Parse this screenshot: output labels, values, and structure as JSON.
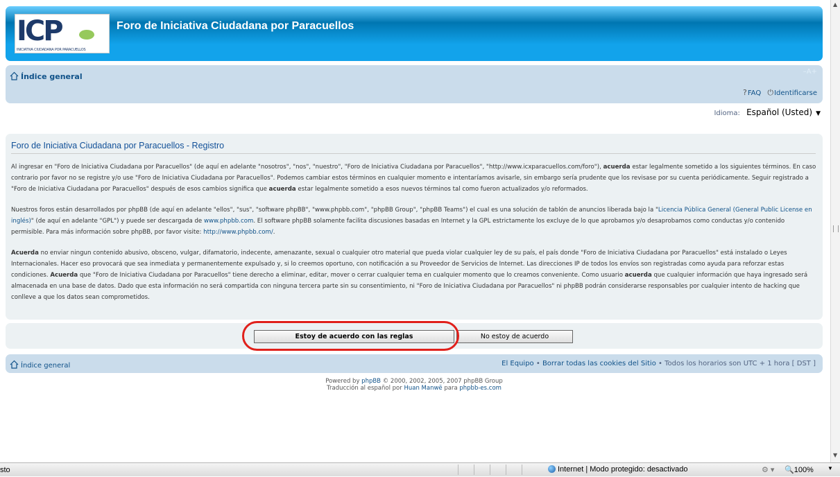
{
  "header": {
    "logo_letters": "ICP",
    "logo_tagline": "INICIATIVA CIUDADANA POR PARACUELLOS",
    "site_title": "Foro de Iniciativa Ciudadana por Paracuellos"
  },
  "navbar": {
    "home_label": "Índice general",
    "font_resize": "–A+",
    "faq_label": "FAQ",
    "login_label": "Identificarse"
  },
  "language": {
    "label": "Idioma:",
    "selected": "Español (Usted)"
  },
  "panel": {
    "title": "Foro de Iniciativa Ciudadana por Paracuellos - Registro",
    "p1_a": "Al ingresar en \"Foro de Iniciativa Ciudadana por Paracuellos\" (de aquí en adelante \"nosotros\", \"nos\", \"nuestro\", \"Foro de Iniciativa Ciudadana por Paracuellos\", \"http://www.icxparacuellos.com/foro\"), ",
    "p1_b": "acuerda",
    "p1_c": " estar legalmente sometido a los siguientes términos. En caso contrario por favor no se registre y/o use \"Foro de Iniciativa Ciudadana por Paracuellos\". Podemos cambiar estos términos en cualquier momento e intentaríamos avisarle, sin embargo sería prudente que los revisase por su cuenta periódicamente. Seguir registrado a \"Foro de Iniciativa Ciudadana por Paracuellos\" después de esos cambios significa que ",
    "p1_d": "acuerda",
    "p1_e": " estar legalmente sometido a esos nuevos términos tal como fueron actualizados y/o reformados.",
    "p2_a": "Nuestros foros están desarrollados por phpBB (de aquí en adelante \"ellos\", \"sus\", \"software phpBB\", \"www.phpbb.com\", \"phpBB Group\", \"phpBB Teams\") el cual es una solución de tablón de anuncios liberada bajo la \"",
    "p2_link1": "Licencia Pública General (General Public License en inglés)",
    "p2_b": "\" (de aquí en adelante \"GPL\") y puede ser descargada de ",
    "p2_link2": "www.phpbb.com",
    "p2_c": ". El software phpBB solamente facilita discusiones basadas en Internet y la GPL estrictamente los excluye de lo que aprobamos y/o desaprobamos como conductas y/o contenido permisible. Para más información sobre phpBB, por favor visite: ",
    "p2_link3": "http://www.phpbb.com/",
    "p2_d": ".",
    "p3_a": "Acuerda",
    "p3_b": " no enviar ningun contenido abusivo, obsceno, vulgar, difamatorio, indecente, amenazante, sexual o cualquier otro material que pueda violar cualquier ley de su país, el país donde \"Foro de Iniciativa Ciudadana por Paracuellos\" está instalado o Leyes Internacionales. Hacer eso provocará que sea inmediata y permanentemente expulsado y, si lo creemos oportuno, con notificación a su Proveedor de Servicios de Internet. Las direcciones IP de todos los envíos son registradas como ayuda para reforzar estas condiciones. ",
    "p3_c": "Acuerda",
    "p3_d": " que \"Foro de Iniciativa Ciudadana por Paracuellos\" tiene derecho a eliminar, editar, mover o cerrar cualquier tema en cualquier momento que lo creamos conveniente. Como usuario ",
    "p3_e": "acuerda",
    "p3_f": " que cualquier información que haya ingresado será almacenada en una base de datos. Dado que esta información no será compartida con ninguna tercera parte sin su consentimiento, ni \"Foro de Iniciativa Ciudadana por Paracuellos\" ni phpBB podrán considerarse responsables por cualquier intento de hacking que conlleve a que los datos sean comprometidos."
  },
  "buttons": {
    "agree": "Estoy de acuerdo con las reglas",
    "disagree": "No estoy de acuerdo"
  },
  "footer": {
    "home_label": "Índice general",
    "team_link": "El Equipo",
    "bullet": " • ",
    "cookies_link": "Borrar todas las cookies del Sitio",
    "timezone": "Todos los horarios son UTC + 1 hora [ DST ]",
    "powered_a": "Powered by ",
    "powered_link": "phpBB",
    "powered_b": " © 2000, 2002, 2005, 2007 phpBB Group",
    "trans_a": "Traducción al español por ",
    "trans_link1": "Huan Manwë",
    "trans_b": " para ",
    "trans_link2": "phpbb-es.com"
  },
  "statusbar": {
    "status_text": "sto",
    "zone_text": "Internet | Modo protegido: desactivado",
    "zoom": "100%"
  },
  "colors": {
    "header_blue": "#0076b1",
    "nav_bg": "#cadceb",
    "panel_bg": "#ecf1f3",
    "link": "#105289",
    "highlight_oval": "#e0201b"
  }
}
